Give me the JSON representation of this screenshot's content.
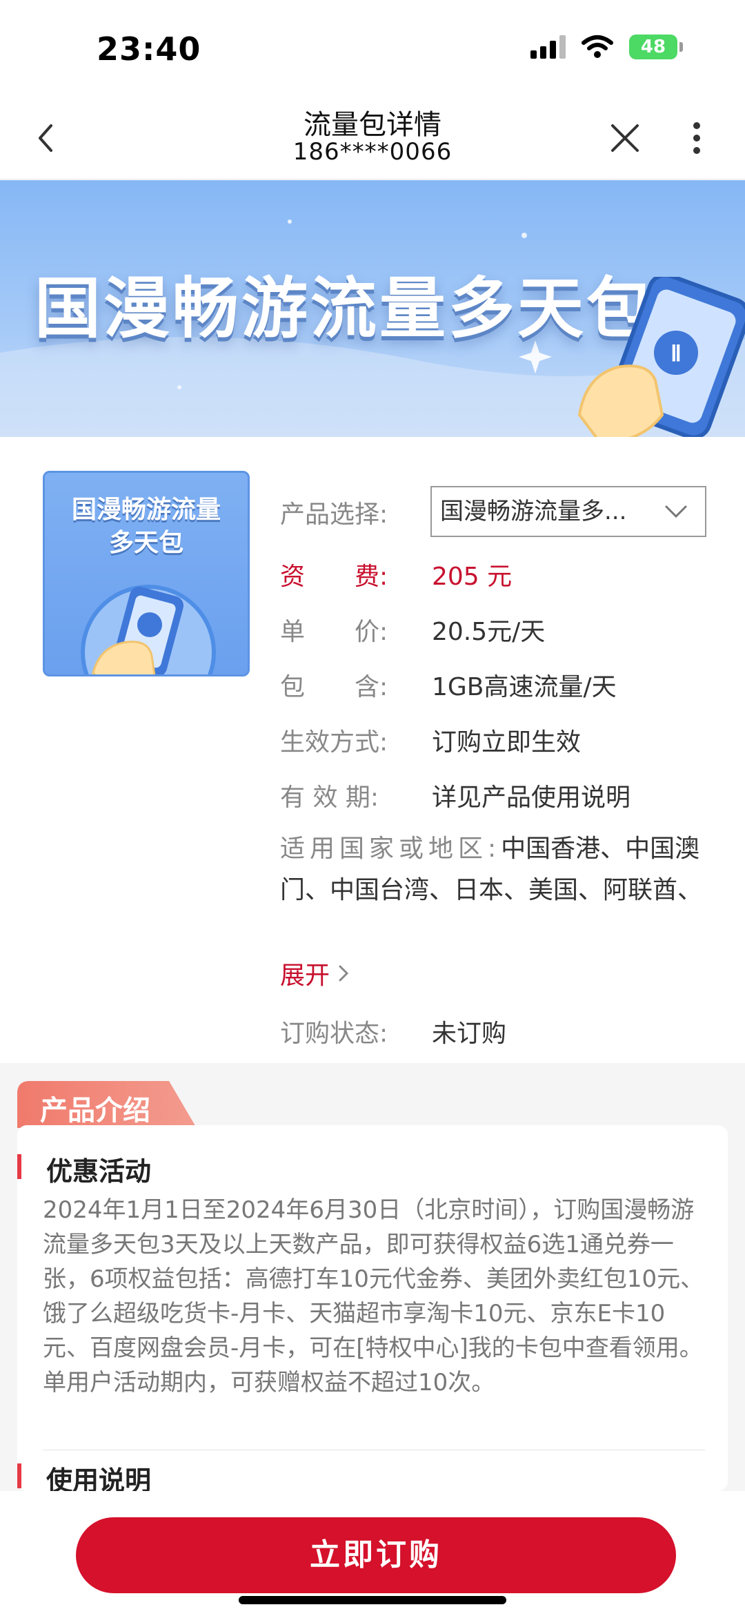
{
  "status_bar": {
    "time": "23:40",
    "battery": "48"
  },
  "nav": {
    "title": "流量包详情",
    "subtitle": "186****0066"
  },
  "banner": {
    "title": "国漫畅游流量多天包"
  },
  "thumbnail": {
    "title_line1": "国漫畅游流量",
    "title_line2": "多天包"
  },
  "product": {
    "select_label": "产品选择:",
    "select_value": "国漫畅游流量多...",
    "fee_label": "资　　费:",
    "fee_value": "205 元",
    "price_label": "单　　价:",
    "price_value": "20.5元/天",
    "includes_label": "包　　含:",
    "includes_value": "1GB高速流量/天",
    "effect_label": "生效方式:",
    "effect_value": "订购立即生效",
    "validity_label": "有 效 期:",
    "validity_value": "详见产品使用说明",
    "region_label": "适用国家或地区:",
    "region_value": "中国香港、中国澳门、中国台湾、日本、美国、阿联酋、",
    "expand_label": "展开",
    "status_label": "订购状态:",
    "status_value": "未订购"
  },
  "intro": {
    "tab_label": "产品介绍",
    "promo_heading": "优惠活动",
    "promo_text": "2024年1月1日至2024年6月30日（北京时间），订购国漫畅游流量多天包3天及以上天数产品，即可获得权益6选1通兑券一张，6项权益包括：高德打车10元代金券、美团外卖红包10元、饿了么超级吃货卡-月卡、天猫超市享淘卡10元、京东E卡10元、百度网盘会员-月卡，可在[特权中心]我的卡包中查看领用。单用户活动期内，可获赠权益不超过10次。",
    "usage_heading": "使用说明"
  },
  "footer": {
    "subscribe_label": "立即订购"
  },
  "colors": {
    "accent_red": "#d5112b",
    "banner_blue": "#86b7f5",
    "battery_green": "#4cd964"
  },
  "icons": [
    "back-icon",
    "close-icon",
    "more-icon",
    "chevron-down-icon",
    "chevron-right-icon",
    "wifi-icon",
    "signal-icon",
    "battery-icon"
  ]
}
